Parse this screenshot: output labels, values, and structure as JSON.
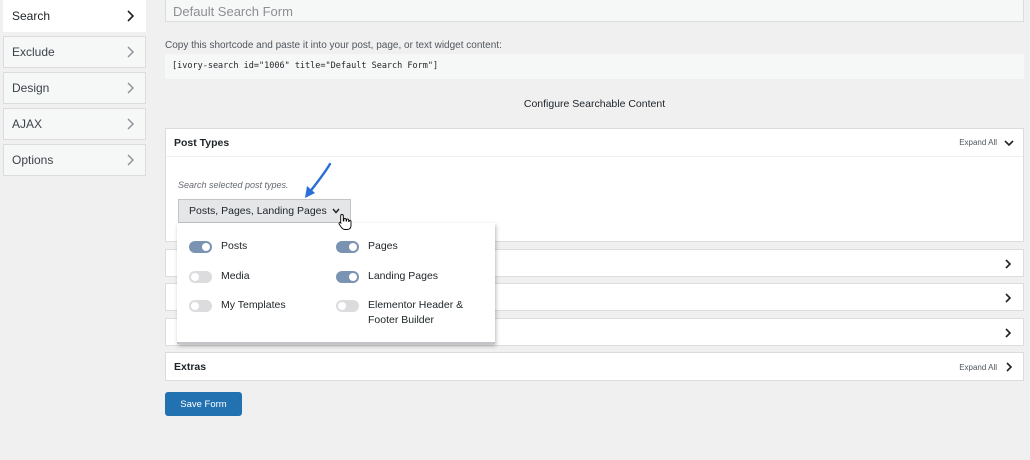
{
  "sidebar": {
    "tabs": [
      {
        "label": "Search",
        "active": true
      },
      {
        "label": "Exclude",
        "active": false
      },
      {
        "label": "Design",
        "active": false
      },
      {
        "label": "AJAX",
        "active": false
      },
      {
        "label": "Options",
        "active": false
      }
    ]
  },
  "form": {
    "title_value": "Default Search Form",
    "shortcode_desc": "Copy this shortcode and paste it into your post, page, or text widget content:",
    "shortcode": "[ivory-search id=\"1006\" title=\"Default Search Form\"]",
    "configure_heading": "Configure Searchable Content",
    "save_label": "Save Form"
  },
  "post_types": {
    "title": "Post Types",
    "expand_label": "Expand All",
    "hint": "Search selected post types.",
    "selected_value": "Posts, Pages, Landing Pages",
    "options": [
      {
        "label": "Posts",
        "enabled": true
      },
      {
        "label": "Pages",
        "enabled": true
      },
      {
        "label": "Media",
        "enabled": false
      },
      {
        "label": "Landing Pages",
        "enabled": true
      },
      {
        "label": "My Templates",
        "enabled": false
      },
      {
        "label": "Elementor Header & Footer Builder",
        "enabled": false
      }
    ]
  },
  "extras": {
    "title": "Extras",
    "expand_label": "Expand All"
  },
  "colors": {
    "primary_button": "#2271b1",
    "toggle_on": "#7b93b2",
    "toggle_off": "#dcdcde",
    "annotation_arrow": "#2b6fd6"
  },
  "icons": {
    "tab_chevron": "chevron-right-icon",
    "panel_expanded": "chevron-down-icon",
    "panel_collapsed": "chevron-right-icon",
    "pointer": "hand-pointer-icon",
    "annotation": "arrow-icon"
  }
}
